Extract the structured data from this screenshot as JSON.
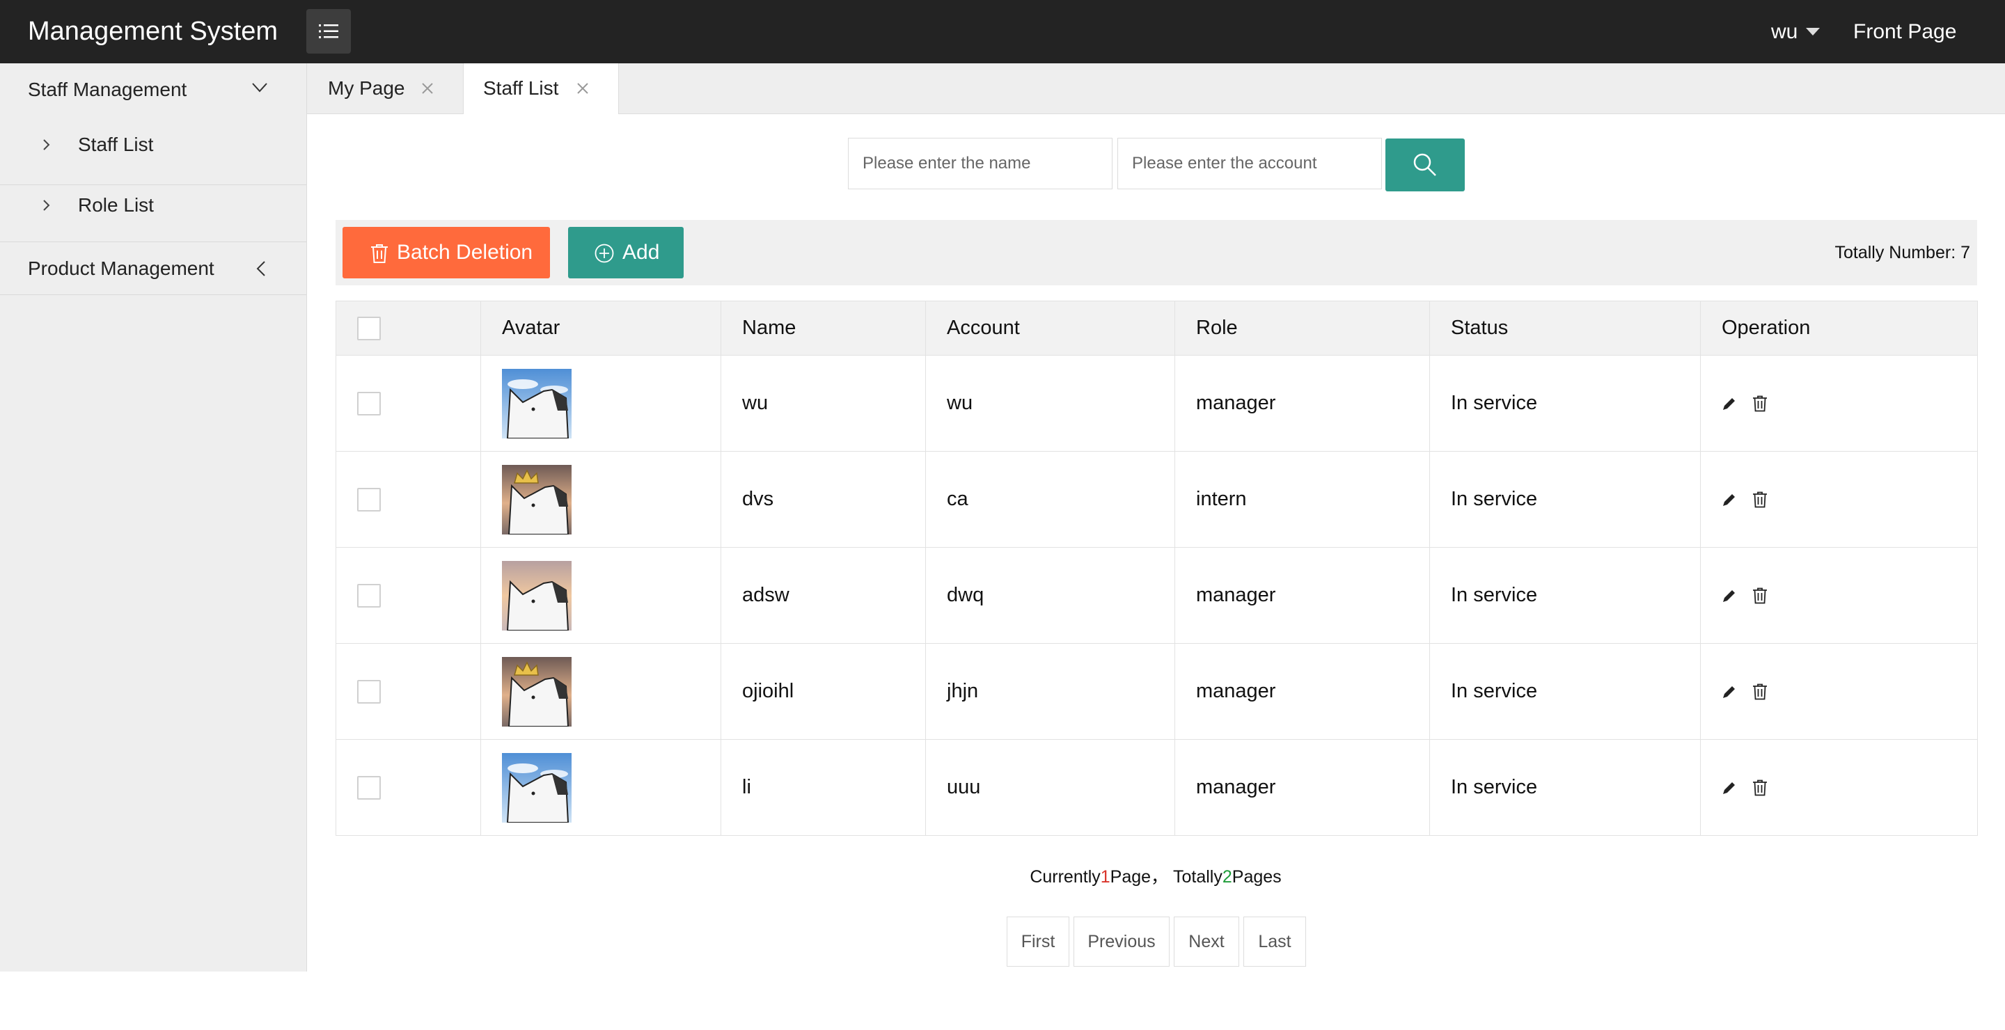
{
  "header": {
    "title": "Management System",
    "user": "wu",
    "front_page": "Front Page"
  },
  "sidebar": {
    "groups": [
      {
        "label": "Staff Management",
        "expanded": true,
        "items": [
          {
            "label": "Staff List"
          },
          {
            "label": "Role List"
          }
        ]
      },
      {
        "label": "Product Management",
        "expanded": false
      }
    ]
  },
  "tabs": [
    {
      "label": "My Page",
      "active": false
    },
    {
      "label": "Staff List",
      "active": true
    }
  ],
  "search": {
    "name_placeholder": "Please enter the name",
    "account_placeholder": "Please enter the account",
    "name_value": "",
    "account_value": ""
  },
  "toolbar": {
    "batch_delete_label": "Batch Deletion",
    "add_label": "Add",
    "total_label": "Totally Number: 7"
  },
  "table": {
    "columns": [
      "Avatar",
      "Name",
      "Account",
      "Role",
      "Status",
      "Operation"
    ],
    "rows": [
      {
        "avatar": "white-dog-sky",
        "name": "wu",
        "account": "wu",
        "role": "manager",
        "status": "In service"
      },
      {
        "avatar": "crowned-dog-sunset",
        "name": "dvs",
        "account": "ca",
        "role": "intern",
        "status": "In service"
      },
      {
        "avatar": "white-dog-sunset",
        "name": "adsw",
        "account": "dwq",
        "role": "manager",
        "status": "In service"
      },
      {
        "avatar": "crowned-dog-sunset",
        "name": "ojioihl",
        "account": "jhjn",
        "role": "manager",
        "status": "In service"
      },
      {
        "avatar": "white-dog-sky",
        "name": "li",
        "account": "uuu",
        "role": "manager",
        "status": "In service"
      }
    ]
  },
  "pagination": {
    "current_prefix": "Currently",
    "current_page": "1",
    "current_suffix": "Page，",
    "total_prefix": "Totally",
    "total_pages": "2",
    "total_suffix": "Pages",
    "first": "First",
    "previous": "Previous",
    "next": "Next",
    "last": "Last"
  },
  "colors": {
    "header_bg": "#232323",
    "accent_teal": "#2f9b8c",
    "delete_orange": "#ff6a3c",
    "current_page_red": "#d9342b",
    "total_pages_green": "#1f9d3a"
  },
  "icons": {
    "menu_toggle": "list-icon",
    "search": "search-icon",
    "batch_delete": "trash-icon",
    "add": "plus-circle-icon",
    "edit": "pencil-icon",
    "delete": "trash-icon",
    "tab_close": "close-icon"
  }
}
